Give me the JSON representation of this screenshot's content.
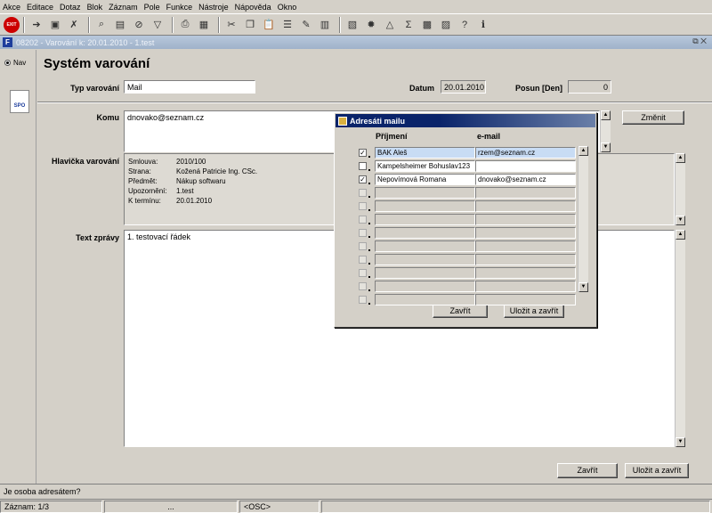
{
  "menu": [
    "Akce",
    "Editace",
    "Dotaz",
    "Blok",
    "Záznam",
    "Pole",
    "Funkce",
    "Nástroje",
    "Nápověda",
    "Okno"
  ],
  "toolbar": {
    "exit_label": "EXIT"
  },
  "window": {
    "title": "08202 - Varování k: 20.01.2010 - 1.test",
    "logo": "F"
  },
  "nav": {
    "label": "Nav",
    "spo_label": "SPO"
  },
  "form": {
    "title": "Systém varování",
    "typ_label": "Typ varování",
    "typ_value": "Mail",
    "datum_label": "Datum",
    "datum_value": "20.01.2010",
    "posun_label": "Posun [Den]",
    "posun_value": "0",
    "komu_label": "Komu",
    "komu_value": "dnovako@seznam.cz",
    "zmenit_label": "Změnit",
    "hlavicka_label": "Hlavička varování",
    "hlavicka": [
      {
        "k": "Smlouva:",
        "v": "2010/100"
      },
      {
        "k": "Strana:",
        "v": "Kožená Patricie Ing. CSc."
      },
      {
        "k": "Předmět:",
        "v": "Nákup softwaru"
      },
      {
        "k": "Upozornění:",
        "v": "1.test"
      },
      {
        "k": "K termínu:",
        "v": "20.01.2010"
      }
    ],
    "text_label": "Text zprávy",
    "text_value": "1. testovací řádek",
    "zavrit_label": "Zavřít",
    "ulozit_label": "Uložit a zavřít"
  },
  "dialog": {
    "title": "Adresáti mailu",
    "col_prijmeni": "Příjmení",
    "col_email": "e-mail",
    "rows": [
      {
        "checked": true,
        "prijmeni": "BAK Aleš",
        "email": "rzem@seznam.cz"
      },
      {
        "checked": false,
        "prijmeni": "Kampelsheimer Bohuslav123",
        "email": ""
      },
      {
        "checked": true,
        "prijmeni": "Nepovímová Romana",
        "email": "dnovako@seznam.cz"
      }
    ],
    "empty_rows": 9,
    "zavrit_label": "Zavřít",
    "ulozit_label": "Uložit a zavřít"
  },
  "status": {
    "message": "Je osoba adresátem?",
    "record": "Záznam: 1/3",
    "cell2": "...",
    "osc": "<OSC>"
  }
}
